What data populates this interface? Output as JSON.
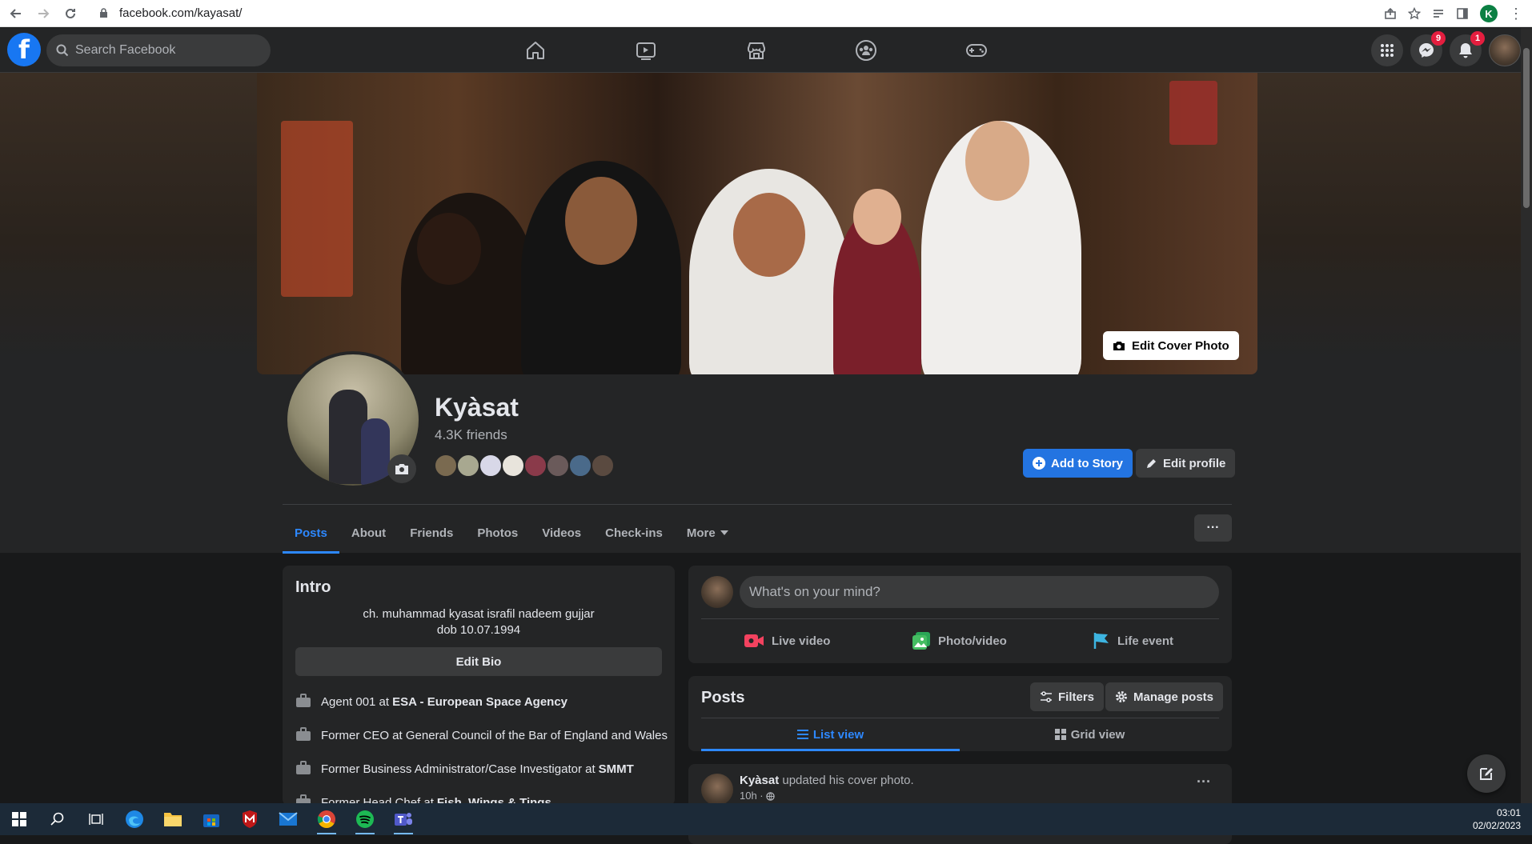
{
  "browser": {
    "url": "facebook.com/kayasat/",
    "profile_initial": "K"
  },
  "header": {
    "logo": "f",
    "search_placeholder": "Search Facebook",
    "nav_icons": [
      "home-icon",
      "watch-icon",
      "marketplace-icon",
      "groups-icon",
      "gaming-icon"
    ],
    "messenger_badge": "9",
    "notifications_badge": "1"
  },
  "profile": {
    "name": "Kyàsat",
    "friends": "4.3K friends",
    "edit_cover": "Edit Cover Photo",
    "add_to_story": "Add to Story",
    "edit_profile": "Edit profile"
  },
  "tabs": [
    {
      "label": "Posts",
      "active": true
    },
    {
      "label": "About"
    },
    {
      "label": "Friends"
    },
    {
      "label": "Photos"
    },
    {
      "label": "Videos"
    },
    {
      "label": "Check-ins"
    },
    {
      "label": "More"
    }
  ],
  "intro": {
    "title": "Intro",
    "bio_line1": "ch. muhammad kyasat israfil nadeem gujjar",
    "bio_line2": "dob 10.07.1994",
    "edit_bio": "Edit Bio",
    "work": [
      {
        "prefix": "Agent 001 at",
        "org": "ESA - European Space Agency"
      },
      {
        "prefix": "Former CEO at General Council of the Bar of England and Wales",
        "org": ""
      },
      {
        "prefix": "Former Business Administrator/Case Investigator at",
        "org": "SMMT"
      },
      {
        "prefix": "Former Head Chef at",
        "org": "Fish, Wings & Tings"
      }
    ]
  },
  "composer": {
    "placeholder": "What's on your mind?",
    "live_video": "Live video",
    "photo_video": "Photo/video",
    "life_event": "Life event"
  },
  "posts_bar": {
    "title": "Posts",
    "filters": "Filters",
    "manage": "Manage posts",
    "list_view": "List view",
    "grid_view": "Grid view"
  },
  "post": {
    "author": "Kyàsat",
    "action": "updated his cover photo.",
    "time": "10h ·"
  },
  "taskbar": {
    "time": "03:01",
    "date": "02/02/2023"
  },
  "colors": {
    "accent": "#2d88ff",
    "button_blue": "#2374e1",
    "badge_red": "#e41e3f",
    "bg": "#18191a",
    "card": "#242526"
  }
}
